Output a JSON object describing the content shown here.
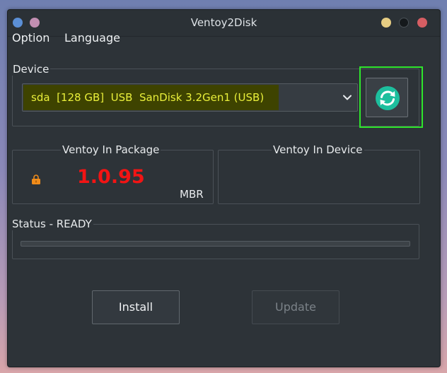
{
  "window": {
    "title": "Ventoy2Disk"
  },
  "menu": {
    "items": [
      {
        "label": "Option"
      },
      {
        "label": "Language"
      }
    ]
  },
  "device": {
    "group_label": "Device",
    "selected": "sda  [128 GB]  USB  SanDisk 3.2Gen1 (USB)",
    "refresh_icon": "refresh-icon",
    "colors": {
      "highlight_bg": "#3e4300",
      "highlight_text": "#e9ef3a",
      "refresh_outline": "#2ee52c",
      "refresh_icon": "#1dbf9e"
    }
  },
  "package": {
    "group_label": "Ventoy In Package",
    "version": "1.0.95",
    "partition_style": "MBR",
    "lock_icon": "lock-icon",
    "colors": {
      "version": "#f21414",
      "lock": "#f08c1a"
    }
  },
  "in_device": {
    "group_label": "Ventoy In Device"
  },
  "status": {
    "label": "Status - READY",
    "progress": 0.0
  },
  "buttons": {
    "install_label": "Install",
    "update_label": "Update",
    "update_enabled": false
  }
}
